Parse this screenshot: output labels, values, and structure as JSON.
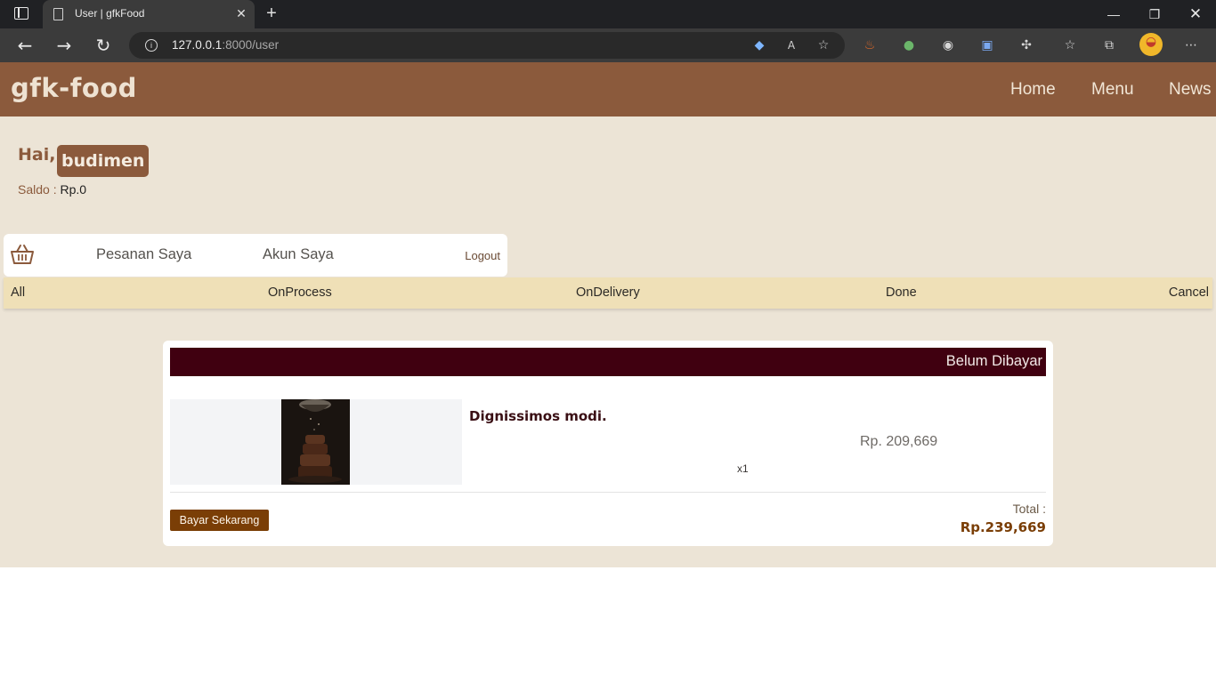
{
  "browser": {
    "tab_title": "User | gfkFood",
    "url_host": "127.0.0.1",
    "url_rest": ":8000/user",
    "icons": {
      "tab_actions": "tab-actions-icon",
      "back": "back-icon",
      "forward": "forward-icon",
      "refresh": "refresh-icon",
      "info": "info-icon"
    }
  },
  "site": {
    "logo": "gfk-food",
    "nav": [
      "Home",
      "Menu",
      "News"
    ],
    "brand_color": "#8b5a3c"
  },
  "user": {
    "greeting": "Hai,",
    "name": "budimen",
    "saldo_label": "Saldo :",
    "saldo_value": "Rp.0"
  },
  "account_menu": {
    "items": [
      "Pesanan Saya",
      "Akun Saya"
    ],
    "logout": "Logout"
  },
  "filters": [
    "All",
    "OnProcess",
    "OnDelivery",
    "Done",
    "Cancel"
  ],
  "order": {
    "status": "Belum Dibayar",
    "product_name": "Dignissimos modi.",
    "price": "Rp. 209,669",
    "quantity": "x1",
    "pay_button": "Bayar Sekarang",
    "total_label": "Total :",
    "total_value": "Rp.239,669"
  }
}
